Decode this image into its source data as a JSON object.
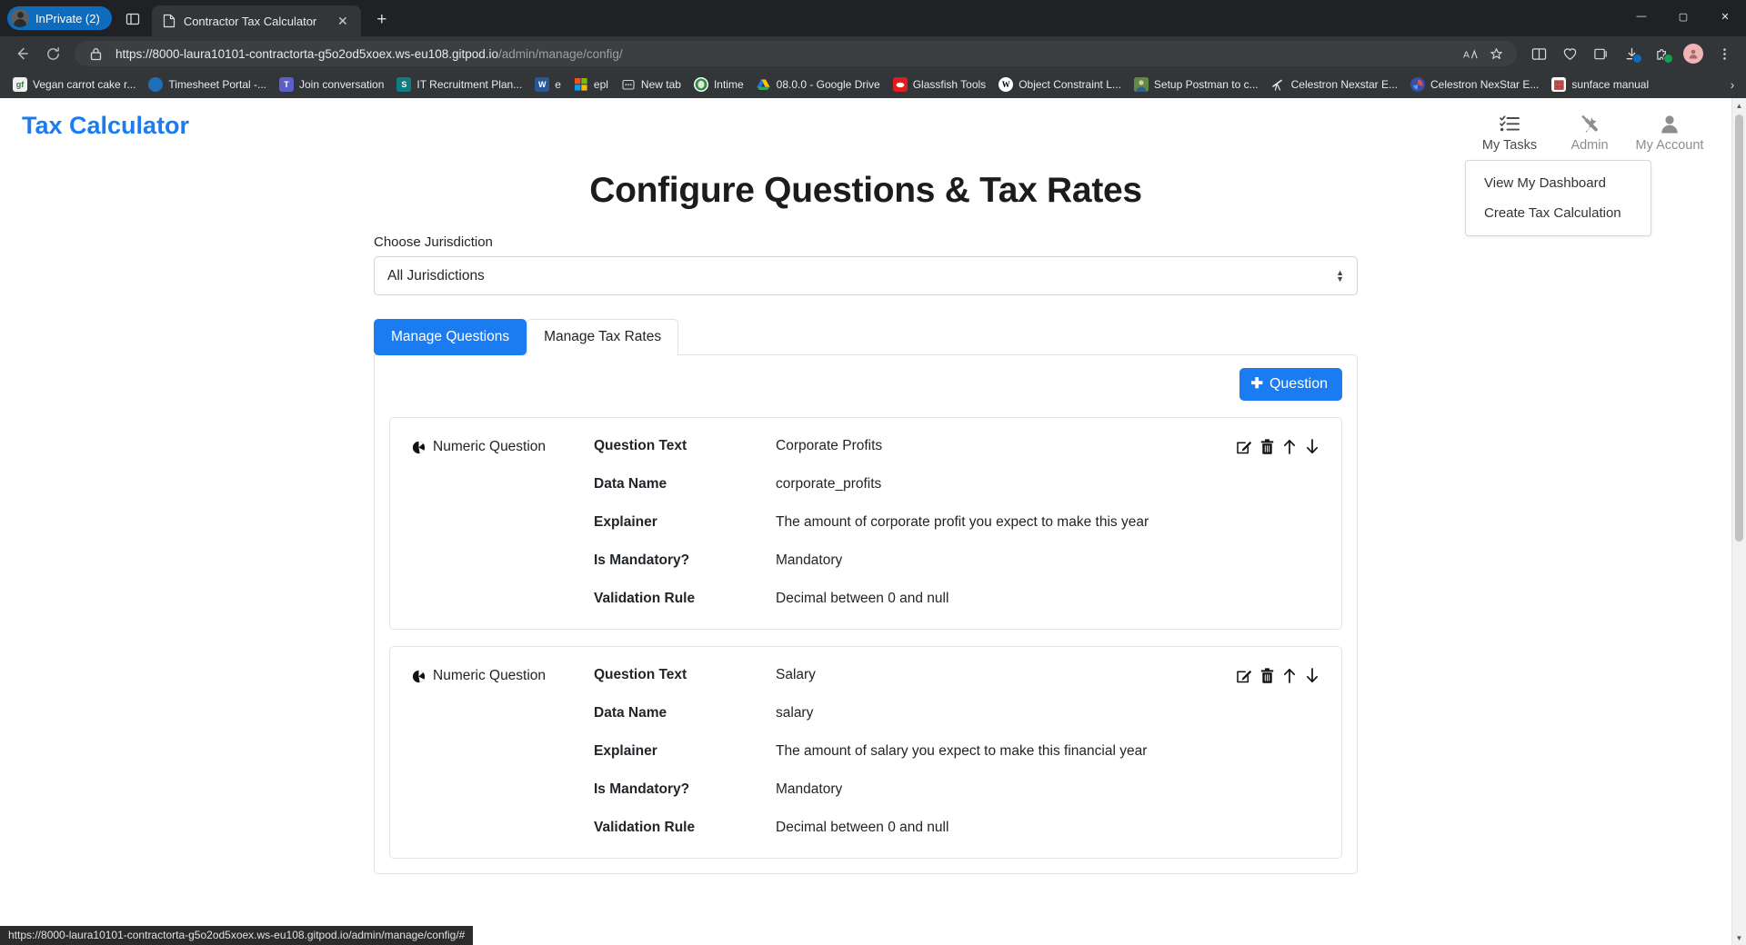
{
  "browser": {
    "inprivate_label": "InPrivate (2)",
    "tab_title": "Contractor Tax Calculator",
    "tab_close": "✕",
    "new_tab": "+",
    "window_minimize": "—",
    "window_maximize": "▢",
    "window_close": "✕",
    "url_prefix": "https://8000-laura10101-contractorta-g5o2od5xoex.ws-eu108.gitpod.io",
    "url_path": "/admin/manage/config/",
    "status_link": "https://8000-laura10101-contractorta-g5o2od5xoex.ws-eu108.gitpod.io/admin/manage/config/#",
    "bookmarks": [
      {
        "label": "Vegan carrot cake r...",
        "icon": "gf-icon",
        "icon_text": "gf",
        "color": "#f0f0f0",
        "text_color": "#2d7a3e"
      },
      {
        "label": "Timesheet Portal -...",
        "icon": "timesheet-icon",
        "icon_text": "",
        "color": "#1d6fb8",
        "text_color": "#ffffff"
      },
      {
        "label": "Join conversation",
        "icon": "teams-icon",
        "icon_text": "T",
        "color": "#5b5fc7",
        "text_color": "#ffffff"
      },
      {
        "label": "IT Recruitment Plan...",
        "icon": "sharepoint-icon",
        "icon_text": "S",
        "color": "#0f7c84",
        "text_color": "#ffffff"
      },
      {
        "label": "e",
        "icon": "word-icon",
        "icon_text": "W",
        "color": "#2b5797",
        "text_color": "#ffffff"
      },
      {
        "label": "epl",
        "icon": "microsoft-icon",
        "icon_text": "",
        "color": "#f25022",
        "text_color": "#ffffff"
      },
      {
        "label": "New tab",
        "icon": "newtab-icon",
        "icon_text": "▤",
        "color": "#3b3f42",
        "text_color": "#e8eaed"
      },
      {
        "label": "Intime",
        "icon": "intime-icon",
        "icon_text": "",
        "color": "#3a8a3a",
        "text_color": "#ffffff"
      },
      {
        "label": "08.0.0 - Google Drive",
        "icon": "google-drive-icon",
        "icon_text": "",
        "color": "#ffffff",
        "text_color": "#1a73e8"
      },
      {
        "label": "Glassfish Tools",
        "icon": "glassfish-icon",
        "icon_text": "",
        "color": "#e01c21",
        "text_color": "#ffffff"
      },
      {
        "label": "Object Constraint L...",
        "icon": "wikipedia-icon",
        "icon_text": "W",
        "color": "#ffffff",
        "text_color": "#000000"
      },
      {
        "label": "Setup Postman to c...",
        "icon": "photo-icon",
        "icon_text": "",
        "color": "#6b8e4e",
        "text_color": "#ffffff"
      },
      {
        "label": "Celestron Nexstar E...",
        "icon": "telescope-icon",
        "icon_text": "",
        "color": "#323639",
        "text_color": "#e8eaed"
      },
      {
        "label": "Celestron NexStar E...",
        "icon": "camera-icon",
        "icon_text": "",
        "color": "#3b4ba8",
        "text_color": "#ffffff"
      },
      {
        "label": "sunface manual",
        "icon": "qr-icon",
        "icon_text": "▩",
        "color": "#ffffff",
        "text_color": "#b03a3a"
      }
    ],
    "bookmarks_overflow": "›"
  },
  "app": {
    "brand": "Tax Calculator",
    "nav": [
      {
        "label": "My Tasks",
        "icon": "tasks-list-icon",
        "muted": false
      },
      {
        "label": "Admin",
        "icon": "tools-icon",
        "muted": true
      },
      {
        "label": "My Account",
        "icon": "user-icon",
        "muted": true
      }
    ],
    "dropdown": {
      "items": [
        {
          "label": "View My Dashboard"
        },
        {
          "label": "Create Tax Calculation"
        }
      ]
    }
  },
  "main": {
    "page_title": "Configure Questions & Tax Rates",
    "jurisdiction_label": "Choose Jurisdiction",
    "jurisdiction_value": "All Jurisdictions",
    "tabs": [
      {
        "label": "Manage Questions",
        "active": true
      },
      {
        "label": "Manage Tax Rates",
        "active": false
      }
    ],
    "add_question_label": "Question",
    "add_question_plus": "✚",
    "field_labels": {
      "question_text": "Question Text",
      "data_name": "Data Name",
      "explainer": "Explainer",
      "is_mandatory": "Is Mandatory?",
      "validation_rule": "Validation Rule"
    },
    "questions": [
      {
        "type_label": "Numeric Question",
        "type_icon": "pie-chart-icon",
        "question_text": "Corporate Profits",
        "data_name": "corporate_profits",
        "explainer": "The amount of corporate profit you expect to make this year",
        "is_mandatory": "Mandatory",
        "validation_rule": "Decimal between 0 and null",
        "actions": [
          {
            "name": "edit-question-button",
            "glyph": "edit"
          },
          {
            "name": "delete-question-button",
            "glyph": "trash"
          },
          {
            "name": "move-question-up-button",
            "glyph": "up"
          },
          {
            "name": "move-question-down-button",
            "glyph": "down"
          }
        ]
      },
      {
        "type_label": "Numeric Question",
        "type_icon": "pie-chart-icon",
        "question_text": "Salary",
        "data_name": "salary",
        "explainer": "The amount of salary you expect to make this financial year",
        "is_mandatory": "Mandatory",
        "validation_rule": "Decimal between 0 and null",
        "actions": [
          {
            "name": "edit-question-button",
            "glyph": "edit"
          },
          {
            "name": "delete-question-button",
            "glyph": "trash"
          },
          {
            "name": "move-question-up-button",
            "glyph": "up"
          },
          {
            "name": "move-question-down-button",
            "glyph": "down"
          }
        ]
      }
    ]
  },
  "colors": {
    "accent": "#1a7cf0",
    "chrome": "#323639",
    "chrome_dark": "#202124"
  }
}
